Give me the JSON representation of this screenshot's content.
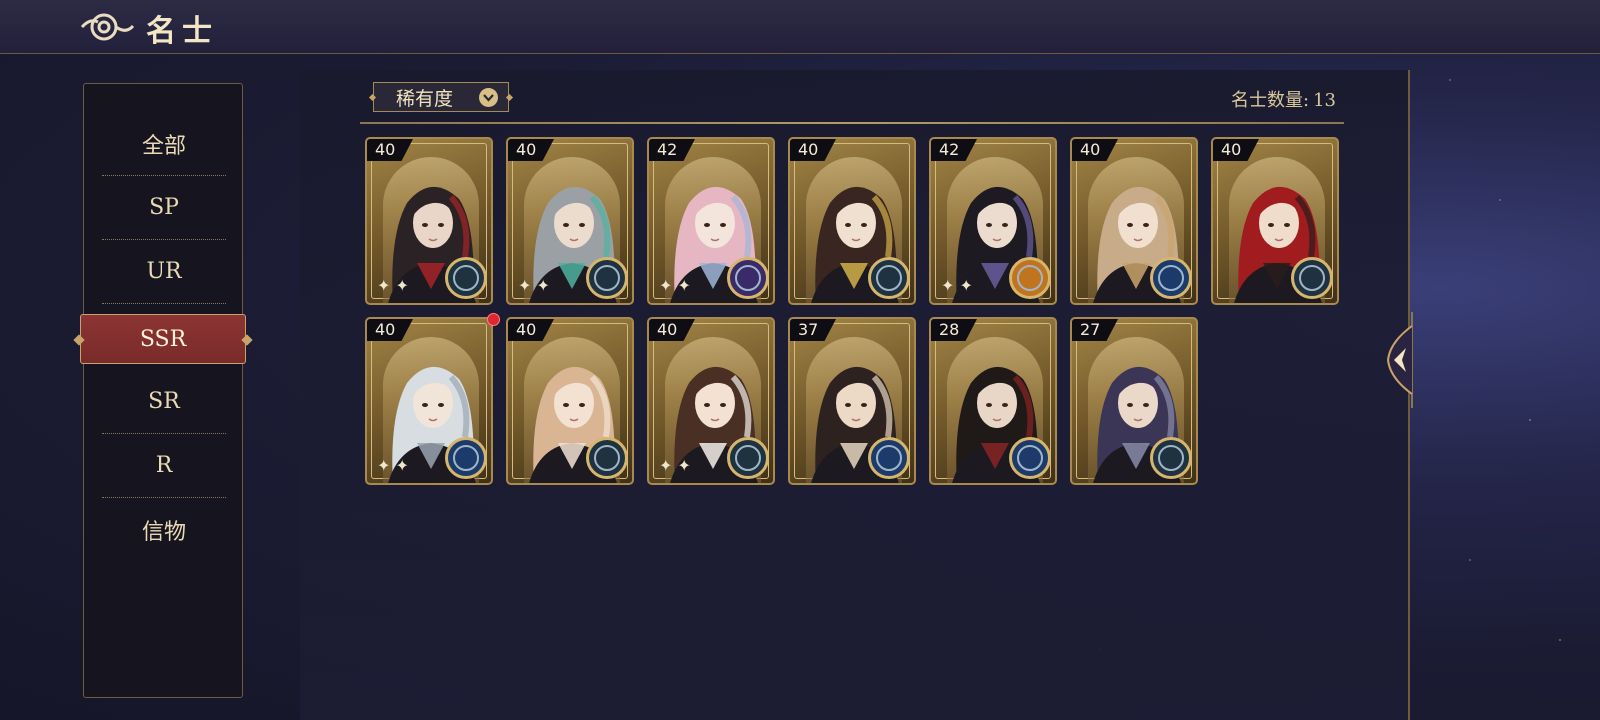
{
  "header": {
    "title": "名士"
  },
  "sidebar": {
    "items": [
      {
        "label": "全部"
      },
      {
        "label": "SP"
      },
      {
        "label": "UR"
      },
      {
        "label": "SSR"
      },
      {
        "label": "SR"
      },
      {
        "label": "R"
      },
      {
        "label": "信物"
      }
    ],
    "active_index": 3
  },
  "toolbar": {
    "filter_label": "稀有度",
    "count_label": "名士数量:",
    "count_value": "13"
  },
  "cards": [
    {
      "level": "40",
      "hair": "#2a2224",
      "accent": "#a8242a",
      "skin": "#e9d6c8",
      "badge": "#1f3240",
      "sparkle": true
    },
    {
      "level": "40",
      "hair": "#9aa0a4",
      "accent": "#4fb3a0",
      "skin": "#ecdccd",
      "badge": "#1f3240",
      "sparkle": true
    },
    {
      "level": "42",
      "hair": "#e6b6c2",
      "accent": "#9fb6d8",
      "skin": "#f3e4dc",
      "badge": "#3a2a6a",
      "sparkle": true
    },
    {
      "level": "40",
      "hair": "#3a2620",
      "accent": "#d4b24a",
      "skin": "#f0e0d0",
      "badge": "#1f3240",
      "sparkle": false
    },
    {
      "level": "42",
      "hair": "#1e1a22",
      "accent": "#6a5fa0",
      "skin": "#ecdcd0",
      "badge": "#c0741e",
      "sparkle": true
    },
    {
      "level": "40",
      "hair": "#c8ac8a",
      "accent": "#c9a46a",
      "skin": "#f1e0cf",
      "badge": "#1c3a6a",
      "sparkle": false
    },
    {
      "level": "40",
      "hair": "#a01c1e",
      "accent": "#2a1c1c",
      "skin": "#f0dccb",
      "badge": "#1f3240",
      "sparkle": false
    },
    {
      "level": "40",
      "hair": "#d8dde2",
      "accent": "#9aa6b0",
      "skin": "#f1e4d8",
      "badge": "#1c3a6a",
      "sparkle": true
    },
    {
      "level": "40",
      "hair": "#d9b594",
      "accent": "#f2e3d3",
      "skin": "#f3e2d2",
      "badge": "#1f3240",
      "sparkle": false
    },
    {
      "level": "40",
      "hair": "#4a3024",
      "accent": "#f4f0ea",
      "skin": "#f3e2d2",
      "badge": "#1f3240",
      "sparkle": true
    },
    {
      "level": "37",
      "hair": "#2e2220",
      "accent": "#e7d6c0",
      "skin": "#ecd9c6",
      "badge": "#1c3a6a",
      "sparkle": false
    },
    {
      "level": "28",
      "hair": "#1f1917",
      "accent": "#8a2424",
      "skin": "#e8d6c6",
      "badge": "#1c3a6a",
      "sparkle": false
    },
    {
      "level": "27",
      "hair": "#3c3656",
      "accent": "#8a8cab",
      "skin": "#ead9c8",
      "badge": "#1f3240",
      "sparkle": false
    }
  ],
  "colors": {
    "gold": "#c9a46a",
    "active_tab": "#8c3434",
    "notification": "#e0262e"
  }
}
